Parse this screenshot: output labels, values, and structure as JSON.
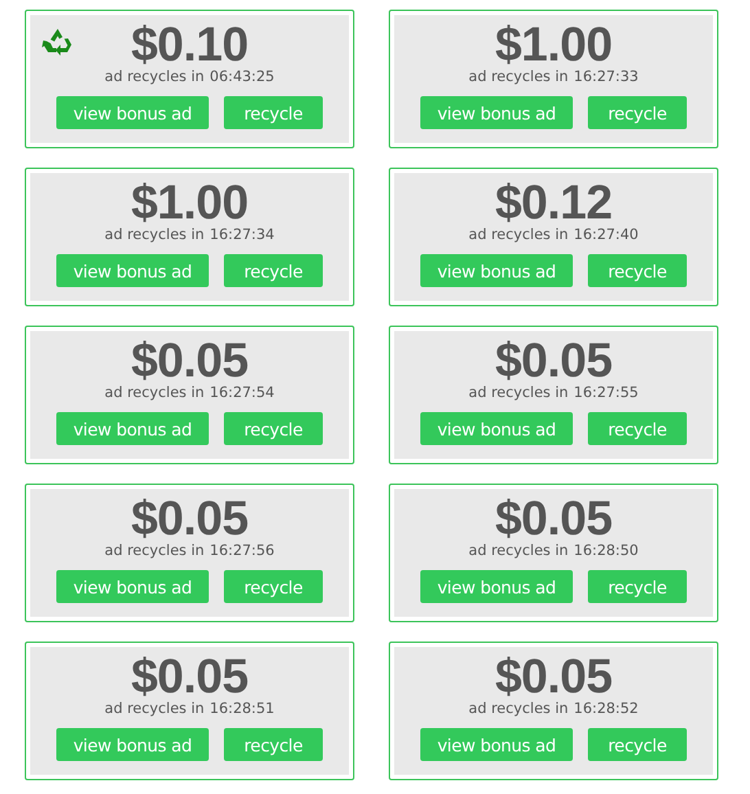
{
  "cards": [
    {
      "recycle_icon": true,
      "amount": "$0.10",
      "countdown_label": "ad recycles in",
      "countdown": "06:43:25",
      "buttons": [
        "view bonus ad",
        "recycle"
      ]
    },
    {
      "recycle_icon": false,
      "amount": "$1.00",
      "countdown_label": "ad recycles in",
      "countdown": "16:27:33",
      "buttons": [
        "view bonus ad",
        "recycle"
      ]
    },
    {
      "recycle_icon": false,
      "amount": "$1.00",
      "countdown_label": "ad recycles in",
      "countdown": "16:27:34",
      "buttons": [
        "view bonus ad",
        "recycle"
      ]
    },
    {
      "recycle_icon": false,
      "amount": "$0.12",
      "countdown_label": "ad recycles in",
      "countdown": "16:27:40",
      "buttons": [
        "view bonus ad",
        "recycle"
      ]
    },
    {
      "recycle_icon": false,
      "amount": "$0.05",
      "countdown_label": "ad recycles in",
      "countdown": "16:27:54",
      "buttons": [
        "view bonus ad",
        "recycle"
      ]
    },
    {
      "recycle_icon": false,
      "amount": "$0.05",
      "countdown_label": "ad recycles in",
      "countdown": "16:27:55",
      "buttons": [
        "view bonus ad",
        "recycle"
      ]
    },
    {
      "recycle_icon": false,
      "amount": "$0.05",
      "countdown_label": "ad recycles in",
      "countdown": "16:27:56",
      "buttons": [
        "view bonus ad",
        "recycle"
      ]
    },
    {
      "recycle_icon": false,
      "amount": "$0.05",
      "countdown_label": "ad recycles in",
      "countdown": "16:28:50",
      "buttons": [
        "view bonus ad",
        "recycle"
      ]
    },
    {
      "recycle_icon": false,
      "amount": "$0.05",
      "countdown_label": "ad recycles in",
      "countdown": "16:28:51",
      "buttons": [
        "view bonus ad",
        "recycle"
      ]
    },
    {
      "recycle_icon": false,
      "amount": "$0.05",
      "countdown_label": "ad recycles in",
      "countdown": "16:28:52",
      "buttons": [
        "view bonus ad",
        "recycle"
      ]
    }
  ]
}
